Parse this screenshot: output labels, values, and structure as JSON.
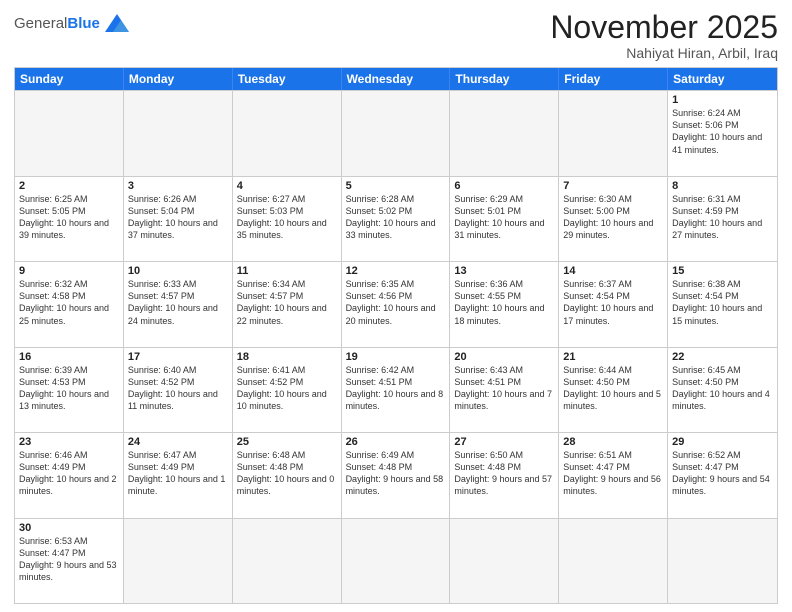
{
  "logo": {
    "text_general": "General",
    "text_blue": "Blue"
  },
  "header": {
    "month": "November 2025",
    "location": "Nahiyat Hiran, Arbil, Iraq"
  },
  "days_of_week": [
    "Sunday",
    "Monday",
    "Tuesday",
    "Wednesday",
    "Thursday",
    "Friday",
    "Saturday"
  ],
  "weeks": [
    [
      {
        "day": "",
        "info": "",
        "empty": true
      },
      {
        "day": "",
        "info": "",
        "empty": true
      },
      {
        "day": "",
        "info": "",
        "empty": true
      },
      {
        "day": "",
        "info": "",
        "empty": true
      },
      {
        "day": "",
        "info": "",
        "empty": true
      },
      {
        "day": "",
        "info": "",
        "empty": true
      },
      {
        "day": "1",
        "info": "Sunrise: 6:24 AM\nSunset: 5:06 PM\nDaylight: 10 hours and 41 minutes.",
        "empty": false
      }
    ],
    [
      {
        "day": "2",
        "info": "Sunrise: 6:25 AM\nSunset: 5:05 PM\nDaylight: 10 hours and 39 minutes.",
        "empty": false
      },
      {
        "day": "3",
        "info": "Sunrise: 6:26 AM\nSunset: 5:04 PM\nDaylight: 10 hours and 37 minutes.",
        "empty": false
      },
      {
        "day": "4",
        "info": "Sunrise: 6:27 AM\nSunset: 5:03 PM\nDaylight: 10 hours and 35 minutes.",
        "empty": false
      },
      {
        "day": "5",
        "info": "Sunrise: 6:28 AM\nSunset: 5:02 PM\nDaylight: 10 hours and 33 minutes.",
        "empty": false
      },
      {
        "day": "6",
        "info": "Sunrise: 6:29 AM\nSunset: 5:01 PM\nDaylight: 10 hours and 31 minutes.",
        "empty": false
      },
      {
        "day": "7",
        "info": "Sunrise: 6:30 AM\nSunset: 5:00 PM\nDaylight: 10 hours and 29 minutes.",
        "empty": false
      },
      {
        "day": "8",
        "info": "Sunrise: 6:31 AM\nSunset: 4:59 PM\nDaylight: 10 hours and 27 minutes.",
        "empty": false
      }
    ],
    [
      {
        "day": "9",
        "info": "Sunrise: 6:32 AM\nSunset: 4:58 PM\nDaylight: 10 hours and 25 minutes.",
        "empty": false
      },
      {
        "day": "10",
        "info": "Sunrise: 6:33 AM\nSunset: 4:57 PM\nDaylight: 10 hours and 24 minutes.",
        "empty": false
      },
      {
        "day": "11",
        "info": "Sunrise: 6:34 AM\nSunset: 4:57 PM\nDaylight: 10 hours and 22 minutes.",
        "empty": false
      },
      {
        "day": "12",
        "info": "Sunrise: 6:35 AM\nSunset: 4:56 PM\nDaylight: 10 hours and 20 minutes.",
        "empty": false
      },
      {
        "day": "13",
        "info": "Sunrise: 6:36 AM\nSunset: 4:55 PM\nDaylight: 10 hours and 18 minutes.",
        "empty": false
      },
      {
        "day": "14",
        "info": "Sunrise: 6:37 AM\nSunset: 4:54 PM\nDaylight: 10 hours and 17 minutes.",
        "empty": false
      },
      {
        "day": "15",
        "info": "Sunrise: 6:38 AM\nSunset: 4:54 PM\nDaylight: 10 hours and 15 minutes.",
        "empty": false
      }
    ],
    [
      {
        "day": "16",
        "info": "Sunrise: 6:39 AM\nSunset: 4:53 PM\nDaylight: 10 hours and 13 minutes.",
        "empty": false
      },
      {
        "day": "17",
        "info": "Sunrise: 6:40 AM\nSunset: 4:52 PM\nDaylight: 10 hours and 11 minutes.",
        "empty": false
      },
      {
        "day": "18",
        "info": "Sunrise: 6:41 AM\nSunset: 4:52 PM\nDaylight: 10 hours and 10 minutes.",
        "empty": false
      },
      {
        "day": "19",
        "info": "Sunrise: 6:42 AM\nSunset: 4:51 PM\nDaylight: 10 hours and 8 minutes.",
        "empty": false
      },
      {
        "day": "20",
        "info": "Sunrise: 6:43 AM\nSunset: 4:51 PM\nDaylight: 10 hours and 7 minutes.",
        "empty": false
      },
      {
        "day": "21",
        "info": "Sunrise: 6:44 AM\nSunset: 4:50 PM\nDaylight: 10 hours and 5 minutes.",
        "empty": false
      },
      {
        "day": "22",
        "info": "Sunrise: 6:45 AM\nSunset: 4:50 PM\nDaylight: 10 hours and 4 minutes.",
        "empty": false
      }
    ],
    [
      {
        "day": "23",
        "info": "Sunrise: 6:46 AM\nSunset: 4:49 PM\nDaylight: 10 hours and 2 minutes.",
        "empty": false
      },
      {
        "day": "24",
        "info": "Sunrise: 6:47 AM\nSunset: 4:49 PM\nDaylight: 10 hours and 1 minute.",
        "empty": false
      },
      {
        "day": "25",
        "info": "Sunrise: 6:48 AM\nSunset: 4:48 PM\nDaylight: 10 hours and 0 minutes.",
        "empty": false
      },
      {
        "day": "26",
        "info": "Sunrise: 6:49 AM\nSunset: 4:48 PM\nDaylight: 9 hours and 58 minutes.",
        "empty": false
      },
      {
        "day": "27",
        "info": "Sunrise: 6:50 AM\nSunset: 4:48 PM\nDaylight: 9 hours and 57 minutes.",
        "empty": false
      },
      {
        "day": "28",
        "info": "Sunrise: 6:51 AM\nSunset: 4:47 PM\nDaylight: 9 hours and 56 minutes.",
        "empty": false
      },
      {
        "day": "29",
        "info": "Sunrise: 6:52 AM\nSunset: 4:47 PM\nDaylight: 9 hours and 54 minutes.",
        "empty": false
      }
    ],
    [
      {
        "day": "30",
        "info": "Sunrise: 6:53 AM\nSunset: 4:47 PM\nDaylight: 9 hours and 53 minutes.",
        "empty": false
      },
      {
        "day": "",
        "info": "",
        "empty": true
      },
      {
        "day": "",
        "info": "",
        "empty": true
      },
      {
        "day": "",
        "info": "",
        "empty": true
      },
      {
        "day": "",
        "info": "",
        "empty": true
      },
      {
        "day": "",
        "info": "",
        "empty": true
      },
      {
        "day": "",
        "info": "",
        "empty": true
      }
    ]
  ]
}
